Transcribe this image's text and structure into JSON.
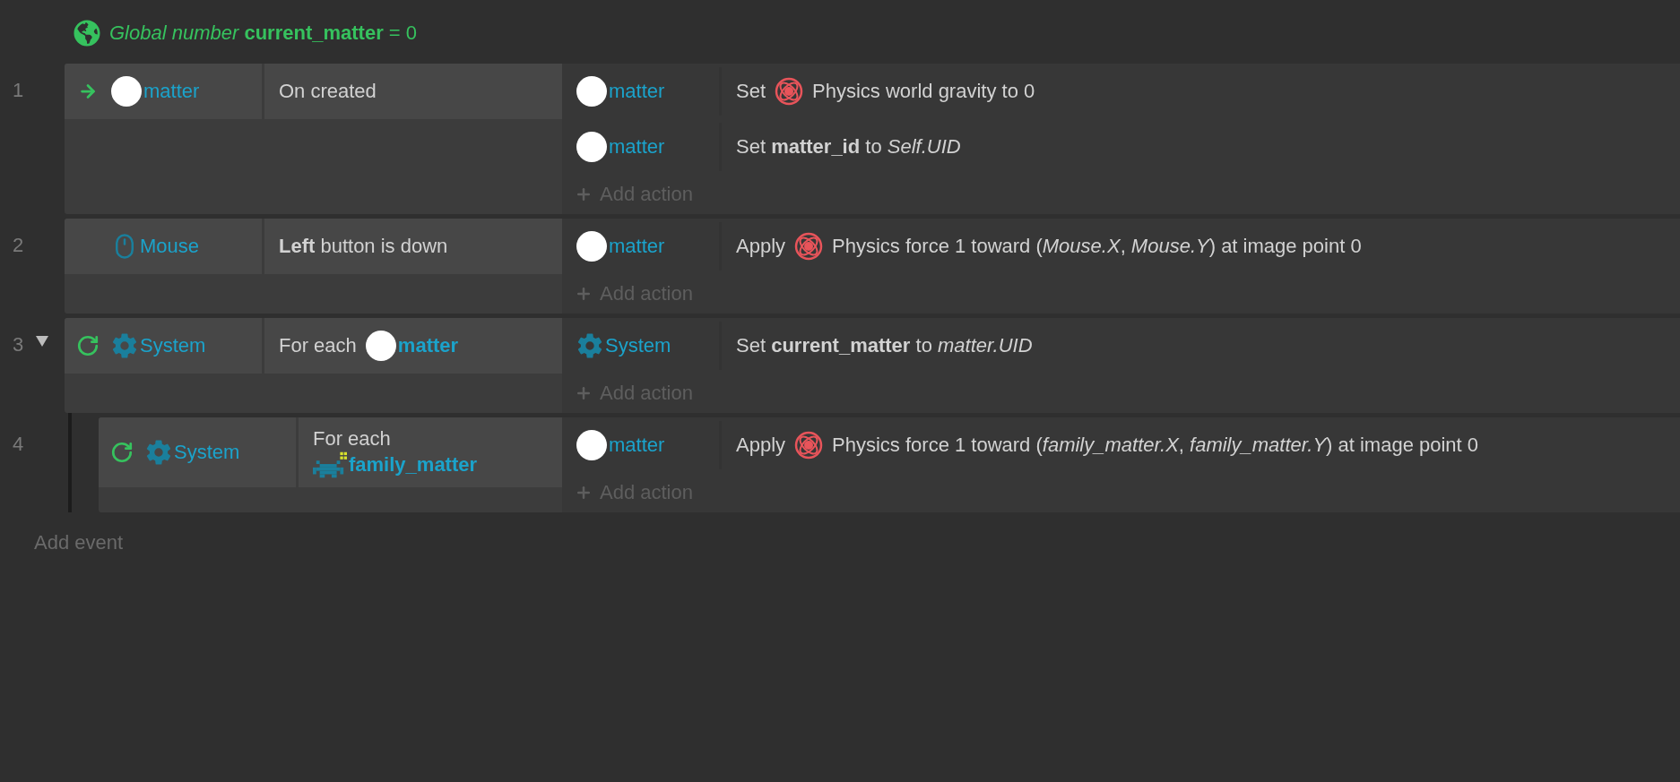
{
  "global_variable": {
    "text": "*Global number* **current_matter** = 0"
  },
  "events": [
    {
      "number": "1",
      "condition": {
        "kind": "trigger",
        "object": {
          "kind": "circle",
          "name": "matter"
        },
        "parts": [
          {
            "kind": "text",
            "text": "On created"
          }
        ]
      },
      "actions": [
        {
          "object": {
            "kind": "circle",
            "name": "matter"
          },
          "parts": [
            {
              "kind": "text",
              "text": "Set"
            },
            {
              "kind": "physics"
            },
            {
              "kind": "text",
              "text": "Physics world gravity to 0"
            }
          ]
        },
        {
          "object": {
            "kind": "circle",
            "name": "matter"
          },
          "parts": [
            {
              "kind": "text",
              "text": "Set **matter_id** to *Self.UID*"
            }
          ]
        }
      ],
      "add_action": "Add action"
    },
    {
      "number": "2",
      "condition": {
        "kind": "plain",
        "object": {
          "kind": "mouse",
          "name": "Mouse"
        },
        "parts": [
          {
            "kind": "text",
            "text": "**Left** button is down"
          }
        ]
      },
      "actions": [
        {
          "object": {
            "kind": "circle",
            "name": "matter"
          },
          "parts": [
            {
              "kind": "text",
              "text": "Apply"
            },
            {
              "kind": "physics"
            },
            {
              "kind": "text",
              "text": "Physics force 1 toward (*Mouse.X*, *Mouse.Y*) at image point 0"
            }
          ]
        }
      ],
      "add_action": "Add action"
    },
    {
      "number": "3",
      "expanded": true,
      "condition": {
        "kind": "loop",
        "object": {
          "kind": "gear",
          "name": "System"
        },
        "parts": [
          {
            "kind": "text",
            "text": "For each"
          },
          {
            "kind": "object",
            "object": {
              "kind": "circle",
              "name": "matter"
            }
          }
        ]
      },
      "actions": [
        {
          "object": {
            "kind": "gear",
            "name": "System"
          },
          "parts": [
            {
              "kind": "text",
              "text": "Set **current_matter** to *matter.UID*"
            }
          ]
        }
      ],
      "add_action": "Add action",
      "children": [
        {
          "number": "4",
          "condition": {
            "kind": "loop",
            "object": {
              "kind": "gear",
              "name": "System"
            },
            "parts": [
              {
                "kind": "text",
                "text": "For each"
              },
              {
                "kind": "object",
                "object": {
                  "kind": "alien",
                  "name": "family_matter"
                }
              }
            ]
          },
          "actions": [
            {
              "object": {
                "kind": "circle",
                "name": "matter"
              },
              "parts": [
                {
                  "kind": "text",
                  "text": "Apply"
                },
                {
                  "kind": "physics"
                },
                {
                  "kind": "text",
                  "text": "Physics force 1 toward (*family_matter.X*, *family_matter.Y*) at image point 0"
                }
              ]
            }
          ],
          "add_action": "Add action"
        }
      ]
    }
  ],
  "add_event": "Add event"
}
